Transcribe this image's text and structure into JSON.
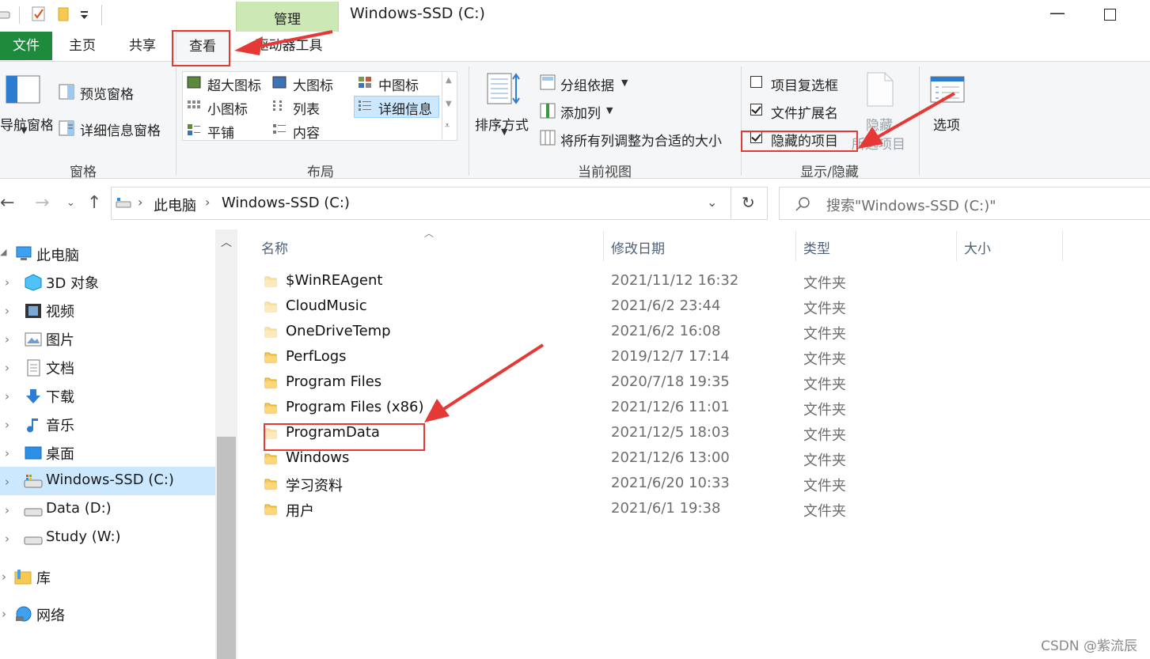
{
  "window": {
    "title": "Windows-SSD (C:)",
    "context_tab": "管理",
    "context_subtab": "驱动器工具"
  },
  "tabs": [
    {
      "label": "文件"
    },
    {
      "label": "主页"
    },
    {
      "label": "共享"
    },
    {
      "label": "查看"
    }
  ],
  "ribbon": {
    "panes": {
      "nav_pane": "导航窗格",
      "preview_pane": "预览窗格",
      "details_pane": "详细信息窗格",
      "group_label": "窗格"
    },
    "layout": {
      "items": [
        "超大图标",
        "大图标",
        "中图标",
        "小图标",
        "列表",
        "详细信息",
        "平铺",
        "内容"
      ],
      "selected": "详细信息",
      "group_label": "布局"
    },
    "current_view": {
      "sort": "排序方式",
      "group_by": "分组依据",
      "add_column": "添加列",
      "fit_columns": "将所有列调整为合适的大小",
      "group_label": "当前视图"
    },
    "show_hide": {
      "item_checkboxes": {
        "label": "项目复选框",
        "checked": false
      },
      "file_extensions": {
        "label": "文件扩展名",
        "checked": true
      },
      "hidden_items": {
        "label": "隐藏的项目",
        "checked": true
      },
      "hide_selected_line1": "隐藏",
      "hide_selected_line2": "所选项目",
      "group_label": "显示/隐藏"
    },
    "options": "选项"
  },
  "address": {
    "crumbs": [
      "此电脑",
      "Windows-SSD (C:)"
    ],
    "search_placeholder": "搜索\"Windows-SSD (C:)\""
  },
  "nav": {
    "root": "此电脑",
    "items": [
      "3D 对象",
      "视频",
      "图片",
      "文档",
      "下载",
      "音乐",
      "桌面",
      "Windows-SSD (C:)",
      "Data (D:)",
      "Study (W:)"
    ],
    "library": "库",
    "network": "网络"
  },
  "columns": [
    "名称",
    "修改日期",
    "类型",
    "大小"
  ],
  "files": [
    {
      "name": "$WinREAgent",
      "date": "2021/11/12 16:32",
      "type": "文件夹",
      "faded": true
    },
    {
      "name": "CloudMusic",
      "date": "2021/6/2 23:44",
      "type": "文件夹",
      "faded": true
    },
    {
      "name": "OneDriveTemp",
      "date": "2021/6/2 16:08",
      "type": "文件夹",
      "faded": true
    },
    {
      "name": "PerfLogs",
      "date": "2019/12/7 17:14",
      "type": "文件夹",
      "faded": false
    },
    {
      "name": "Program Files",
      "date": "2020/7/18 19:35",
      "type": "文件夹",
      "faded": false
    },
    {
      "name": "Program Files (x86)",
      "date": "2021/12/6 11:01",
      "type": "文件夹",
      "faded": false
    },
    {
      "name": "ProgramData",
      "date": "2021/12/5 18:03",
      "type": "文件夹",
      "faded": true
    },
    {
      "name": "Windows",
      "date": "2021/12/6 13:00",
      "type": "文件夹",
      "faded": false
    },
    {
      "name": "学习资料",
      "date": "2021/6/20 10:33",
      "type": "文件夹",
      "faded": false
    },
    {
      "name": "用户",
      "date": "2021/6/1 19:38",
      "type": "文件夹",
      "faded": false
    }
  ],
  "watermark": "CSDN @紫流辰",
  "colors": {
    "file_tab": "#1e8a3c",
    "context_tab": "#cce8b5",
    "selection": "#cce8ff",
    "annotation": "#e53935",
    "folder": "#f8c950"
  }
}
